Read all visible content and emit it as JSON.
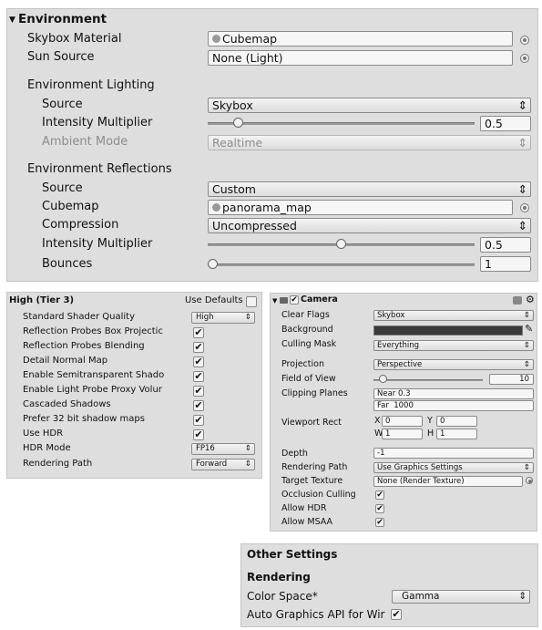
{
  "environment": {
    "header": "Environment",
    "skybox_material": {
      "label": "Skybox Material",
      "value": "Cubemap"
    },
    "sun_source": {
      "label": "Sun Source",
      "value": "None (Light)"
    },
    "lighting_header": "Environment Lighting",
    "lighting_source": {
      "label": "Source",
      "value": "Skybox"
    },
    "lighting_intensity": {
      "label": "Intensity Multiplier",
      "value": "0.5",
      "level": 0.1
    },
    "ambient_mode": {
      "label": "Ambient Mode",
      "value": "Realtime"
    },
    "reflections_header": "Environment Reflections",
    "refl_source": {
      "label": "Source",
      "value": "Custom"
    },
    "refl_cubemap": {
      "label": "Cubemap",
      "value": "panorama_map"
    },
    "refl_compression": {
      "label": "Compression",
      "value": "Uncompressed"
    },
    "refl_intensity": {
      "label": "Intensity Multiplier",
      "value": "0.5",
      "level": 0.5
    },
    "bounces": {
      "label": "Bounces",
      "value": "1",
      "level": 0.0
    }
  },
  "quality": {
    "header": "High (Tier 3)",
    "use_defaults": "Use Defaults",
    "rows": [
      {
        "label": "Standard Shader Quality",
        "value": "High"
      },
      {
        "label": "Reflection Probes Box Projectic",
        "checked": true
      },
      {
        "label": "Reflection Probes Blending",
        "checked": true
      },
      {
        "label": "Detail Normal Map",
        "checked": true
      },
      {
        "label": "Enable Semitransparent Shado",
        "checked": true
      },
      {
        "label": "Enable Light Probe Proxy Volur",
        "checked": true
      },
      {
        "label": "Cascaded Shadows",
        "checked": true
      },
      {
        "label": "Prefer 32 bit shadow maps",
        "checked": true
      },
      {
        "label": "Use HDR",
        "checked": true
      },
      {
        "label": "HDR Mode",
        "value": "FP16"
      },
      {
        "label": "Rendering Path",
        "value": "Forward"
      }
    ]
  },
  "camera": {
    "title": "Camera",
    "clear_flags": {
      "label": "Clear Flags",
      "value": "Skybox"
    },
    "background": {
      "label": "Background",
      "color": "#3a3a3a"
    },
    "culling_mask": {
      "label": "Culling Mask",
      "value": "Everything"
    },
    "projection": {
      "label": "Projection",
      "value": "Perspective"
    },
    "fov": {
      "label": "Field of View",
      "value": "10",
      "level": 0.05
    },
    "clipping": {
      "label": "Clipping Planes",
      "near_label": "Near",
      "near": "0.3",
      "far_label": "Far",
      "far": "1000"
    },
    "viewport": {
      "label": "Viewport Rect",
      "x_label": "X",
      "x": "0",
      "y_label": "Y",
      "y": "0",
      "w_label": "W",
      "w": "1",
      "h_label": "H",
      "h": "1"
    },
    "depth": {
      "label": "Depth",
      "value": "-1"
    },
    "rendering_path": {
      "label": "Rendering Path",
      "value": "Use Graphics Settings"
    },
    "target_texture": {
      "label": "Target Texture",
      "value": "None (Render Texture)"
    },
    "occlusion_culling": {
      "label": "Occlusion Culling",
      "checked": true
    },
    "allow_hdr": {
      "label": "Allow HDR",
      "checked": true
    },
    "allow_msaa": {
      "label": "Allow MSAA",
      "checked": true
    }
  },
  "other": {
    "header": "Other Settings",
    "rendering": "Rendering",
    "color_space": {
      "label": "Color Space*",
      "value": "Gamma"
    },
    "auto_graphics": {
      "label": "Auto Graphics API for Wir",
      "checked": true
    }
  },
  "glyphs": {
    "arrow": "▾",
    "updown": "⇕",
    "check": "✔",
    "picker": "⊙",
    "foldout": "▼",
    "eyedropper": "✎"
  }
}
